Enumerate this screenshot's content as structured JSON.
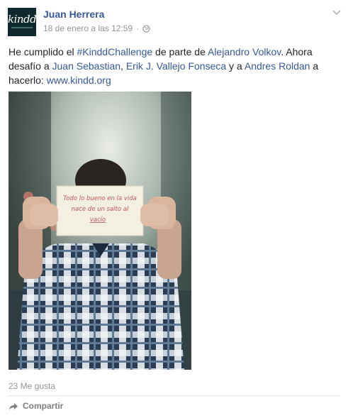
{
  "post": {
    "avatar_text": "kindd",
    "author": "Juan Herrera",
    "date": "18 de enero a las 12:59",
    "separator": "·",
    "text_parts": {
      "p1": "He cumplido el ",
      "hashtag": "#KinddChallenge",
      "p2": " de parte de ",
      "tag1": "Alejandro Volkov",
      "p3": ". Ahora desafío a ",
      "tag2": "Juan Sebastian",
      "p4": ", ",
      "tag3": "Erik J. Vallejo Fonseca",
      "p5": " y a ",
      "tag4": "Andres Roldan",
      "p6": " a hacerlo: ",
      "link": "www.kindd.org"
    },
    "photo_sign": {
      "line1": "Todo lo bueno en la vida",
      "line2": "nace de un salto al",
      "line3": "vacío"
    },
    "likes": "23 Me gusta",
    "share_label": "Compartir"
  },
  "colors": {
    "link": "#365899",
    "meta": "#90949c",
    "avatar_bg": "#0f2a2c"
  }
}
